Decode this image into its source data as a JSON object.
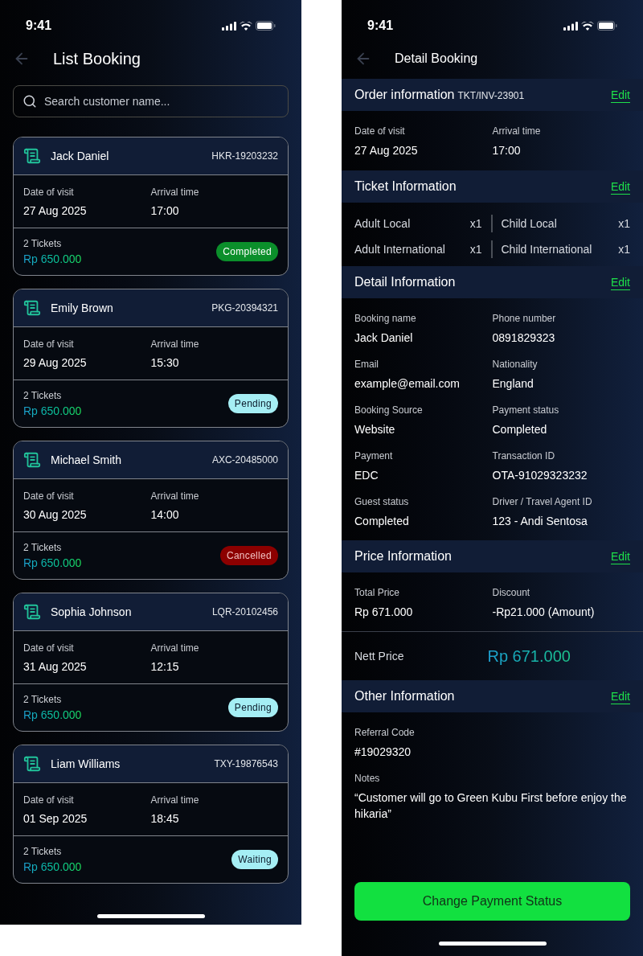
{
  "list_screen": {
    "status_time": "9:41",
    "title": "List Booking",
    "search": {
      "placeholder": "Search customer name..."
    },
    "bookings": [
      {
        "name": "Jack Daniel",
        "code": "HKR-19203232",
        "date_label": "Date of visit",
        "date": "27 Aug 2025",
        "time_label": "Arrival time",
        "time": "17:00",
        "tickets": "2 Tickets",
        "price": "Rp 650.000",
        "status": "Completed",
        "kind": "completed"
      },
      {
        "name": "Emily Brown",
        "code": "PKG-20394321",
        "date_label": "Date of visit",
        "date": "29 Aug 2025",
        "time_label": "Arrival time",
        "time": "15:30",
        "tickets": "2 Tickets",
        "price": "Rp 650.000",
        "status": "Pending",
        "kind": "pending"
      },
      {
        "name": "Michael Smith",
        "code": "AXC-20485000",
        "date_label": "Date of visit",
        "date": "30 Aug 2025",
        "time_label": "Arrival time",
        "time": "14:00",
        "tickets": "2 Tickets",
        "price": "Rp 650.000",
        "status": "Cancelled",
        "kind": "cancelled"
      },
      {
        "name": "Sophia Johnson",
        "code": "LQR-20102456",
        "date_label": "Date of visit",
        "date": "31 Aug 2025",
        "time_label": "Arrival time",
        "time": "12:15",
        "tickets": "2 Tickets",
        "price": "Rp 650.000",
        "status": "Pending",
        "kind": "pending"
      },
      {
        "name": "Liam Williams",
        "code": "TXY-19876543",
        "date_label": "Date of visit",
        "date": "01 Sep 2025",
        "time_label": "Arrival time",
        "time": "18:45",
        "tickets": "2 Tickets",
        "price": "Rp 650.000",
        "status": "Waiting",
        "kind": "waiting"
      }
    ]
  },
  "detail_screen": {
    "status_time": "9:41",
    "title": "Detail Booking",
    "order": {
      "title": "Order information",
      "invoice": "TKT/INV-23901",
      "edit": "Edit",
      "fields": [
        {
          "label": "Date of visit",
          "value": "27 Aug 2025"
        },
        {
          "label": "Arrival time",
          "value": "17:00"
        }
      ]
    },
    "tickets": {
      "title": "Ticket Information",
      "edit": "Edit",
      "items": [
        {
          "name": "Adult Local",
          "qty": "x1"
        },
        {
          "name": "Child Local",
          "qty": "x1"
        },
        {
          "name": "Adult International",
          "qty": "x1"
        },
        {
          "name": "Child International",
          "qty": "x1"
        }
      ]
    },
    "detail": {
      "title": "Detail Information",
      "edit": "Edit",
      "fields": [
        {
          "label": "Booking name",
          "value": "Jack Daniel"
        },
        {
          "label": "Phone number",
          "value": "0891829323"
        },
        {
          "label": "Email",
          "value": "example@email.com"
        },
        {
          "label": "Nationality",
          "value": "England"
        },
        {
          "label": "Booking Source",
          "value": "Website"
        },
        {
          "label": "Payment status",
          "value": "Completed"
        },
        {
          "label": "Payment",
          "value": "EDC"
        },
        {
          "label": "Transaction ID",
          "value": "OTA-91029323232"
        },
        {
          "label": "Guest status",
          "value": "Completed"
        },
        {
          "label": "Driver / Travel Agent ID",
          "value": "123 - Andi Sentosa"
        }
      ]
    },
    "price": {
      "title": "Price Information",
      "edit": "Edit",
      "fields": [
        {
          "label": "Total Price",
          "value": "Rp 671.000"
        },
        {
          "label": "Discount",
          "value": "-Rp21.000 (Amount)"
        }
      ],
      "nett_label": "Nett Price",
      "nett_value": "Rp 671.000"
    },
    "other": {
      "title": "Other Information",
      "edit": "Edit",
      "fields": [
        {
          "label": "Referral Code",
          "value": "#19029320"
        },
        {
          "label": "Notes",
          "value": "“Customer will go to Green Kubu First before enjoy the hikaria”"
        }
      ]
    },
    "button": "Change Payment Status"
  }
}
